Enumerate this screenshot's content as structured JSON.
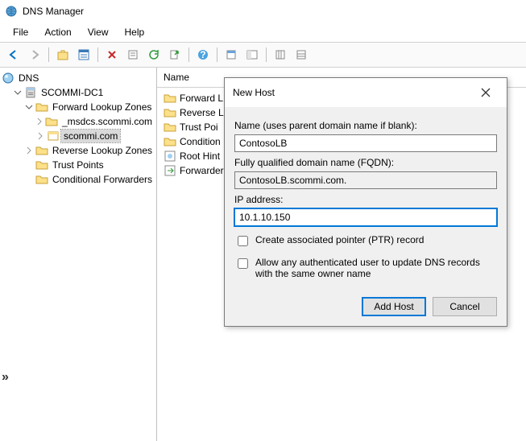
{
  "app": {
    "title": "DNS Manager"
  },
  "menu": {
    "file": "File",
    "action": "Action",
    "view": "View",
    "help": "Help"
  },
  "toolbar_icons": [
    "back-icon",
    "forward-icon",
    "up-icon",
    "details-icon",
    "delete-icon",
    "refresh-icon",
    "export-icon",
    "sep",
    "help-icon",
    "sep",
    "new-icon",
    "props-icon",
    "sep",
    "columns-icon",
    "filter-icon"
  ],
  "tree": {
    "root": "DNS",
    "server": "SCOMMI-DC1",
    "flz": "Forward Lookup Zones",
    "z1": "_msdcs.scommi.com",
    "z2": "scommi.com",
    "rlz": "Reverse Lookup Zones",
    "tp": "Trust Points",
    "cf": "Conditional Forwarders"
  },
  "list": {
    "header": "Name",
    "items": [
      "Forward L",
      "Reverse L",
      "Trust Poi",
      "Condition",
      "Root Hint",
      "Forwarder"
    ]
  },
  "dialog": {
    "title": "New Host",
    "name_label": "Name (uses parent domain name if blank):",
    "name_value": "ContosoLB",
    "fqdn_label": "Fully qualified domain name (FQDN):",
    "fqdn_value": "ContosoLB.scommi.com.",
    "ip_label": "IP address:",
    "ip_value": "10.1.10.150",
    "check_ptr": "Create associated pointer (PTR) record",
    "check_auth": "Allow any authenticated user to update DNS records with the same owner name",
    "btn_add": "Add Host",
    "btn_cancel": "Cancel"
  }
}
